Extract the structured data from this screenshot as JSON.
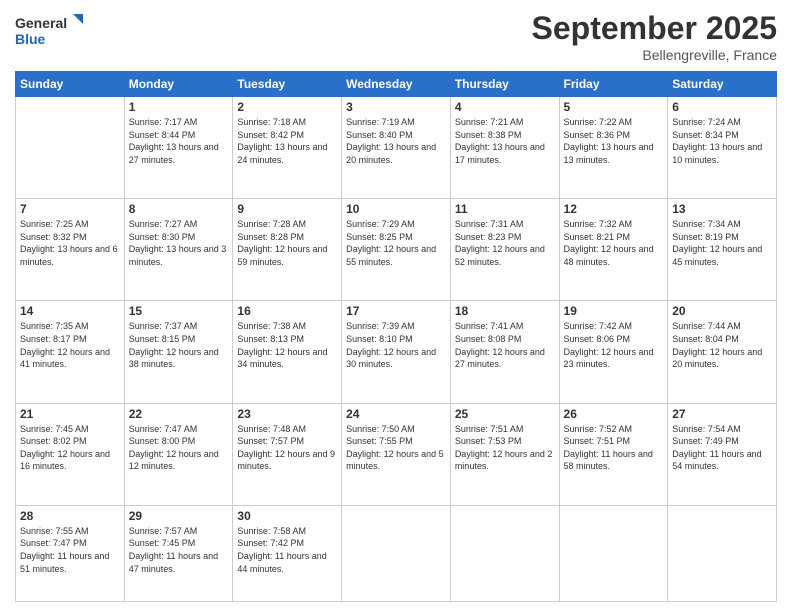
{
  "header": {
    "logo_general": "General",
    "logo_blue": "Blue",
    "month_title": "September 2025",
    "location": "Bellengreville, France"
  },
  "days_of_week": [
    "Sunday",
    "Monday",
    "Tuesday",
    "Wednesday",
    "Thursday",
    "Friday",
    "Saturday"
  ],
  "weeks": [
    [
      {
        "day": "",
        "sunrise": "",
        "sunset": "",
        "daylight": ""
      },
      {
        "day": "1",
        "sunrise": "Sunrise: 7:17 AM",
        "sunset": "Sunset: 8:44 PM",
        "daylight": "Daylight: 13 hours and 27 minutes."
      },
      {
        "day": "2",
        "sunrise": "Sunrise: 7:18 AM",
        "sunset": "Sunset: 8:42 PM",
        "daylight": "Daylight: 13 hours and 24 minutes."
      },
      {
        "day": "3",
        "sunrise": "Sunrise: 7:19 AM",
        "sunset": "Sunset: 8:40 PM",
        "daylight": "Daylight: 13 hours and 20 minutes."
      },
      {
        "day": "4",
        "sunrise": "Sunrise: 7:21 AM",
        "sunset": "Sunset: 8:38 PM",
        "daylight": "Daylight: 13 hours and 17 minutes."
      },
      {
        "day": "5",
        "sunrise": "Sunrise: 7:22 AM",
        "sunset": "Sunset: 8:36 PM",
        "daylight": "Daylight: 13 hours and 13 minutes."
      },
      {
        "day": "6",
        "sunrise": "Sunrise: 7:24 AM",
        "sunset": "Sunset: 8:34 PM",
        "daylight": "Daylight: 13 hours and 10 minutes."
      }
    ],
    [
      {
        "day": "7",
        "sunrise": "Sunrise: 7:25 AM",
        "sunset": "Sunset: 8:32 PM",
        "daylight": "Daylight: 13 hours and 6 minutes."
      },
      {
        "day": "8",
        "sunrise": "Sunrise: 7:27 AM",
        "sunset": "Sunset: 8:30 PM",
        "daylight": "Daylight: 13 hours and 3 minutes."
      },
      {
        "day": "9",
        "sunrise": "Sunrise: 7:28 AM",
        "sunset": "Sunset: 8:28 PM",
        "daylight": "Daylight: 12 hours and 59 minutes."
      },
      {
        "day": "10",
        "sunrise": "Sunrise: 7:29 AM",
        "sunset": "Sunset: 8:25 PM",
        "daylight": "Daylight: 12 hours and 55 minutes."
      },
      {
        "day": "11",
        "sunrise": "Sunrise: 7:31 AM",
        "sunset": "Sunset: 8:23 PM",
        "daylight": "Daylight: 12 hours and 52 minutes."
      },
      {
        "day": "12",
        "sunrise": "Sunrise: 7:32 AM",
        "sunset": "Sunset: 8:21 PM",
        "daylight": "Daylight: 12 hours and 48 minutes."
      },
      {
        "day": "13",
        "sunrise": "Sunrise: 7:34 AM",
        "sunset": "Sunset: 8:19 PM",
        "daylight": "Daylight: 12 hours and 45 minutes."
      }
    ],
    [
      {
        "day": "14",
        "sunrise": "Sunrise: 7:35 AM",
        "sunset": "Sunset: 8:17 PM",
        "daylight": "Daylight: 12 hours and 41 minutes."
      },
      {
        "day": "15",
        "sunrise": "Sunrise: 7:37 AM",
        "sunset": "Sunset: 8:15 PM",
        "daylight": "Daylight: 12 hours and 38 minutes."
      },
      {
        "day": "16",
        "sunrise": "Sunrise: 7:38 AM",
        "sunset": "Sunset: 8:13 PM",
        "daylight": "Daylight: 12 hours and 34 minutes."
      },
      {
        "day": "17",
        "sunrise": "Sunrise: 7:39 AM",
        "sunset": "Sunset: 8:10 PM",
        "daylight": "Daylight: 12 hours and 30 minutes."
      },
      {
        "day": "18",
        "sunrise": "Sunrise: 7:41 AM",
        "sunset": "Sunset: 8:08 PM",
        "daylight": "Daylight: 12 hours and 27 minutes."
      },
      {
        "day": "19",
        "sunrise": "Sunrise: 7:42 AM",
        "sunset": "Sunset: 8:06 PM",
        "daylight": "Daylight: 12 hours and 23 minutes."
      },
      {
        "day": "20",
        "sunrise": "Sunrise: 7:44 AM",
        "sunset": "Sunset: 8:04 PM",
        "daylight": "Daylight: 12 hours and 20 minutes."
      }
    ],
    [
      {
        "day": "21",
        "sunrise": "Sunrise: 7:45 AM",
        "sunset": "Sunset: 8:02 PM",
        "daylight": "Daylight: 12 hours and 16 minutes."
      },
      {
        "day": "22",
        "sunrise": "Sunrise: 7:47 AM",
        "sunset": "Sunset: 8:00 PM",
        "daylight": "Daylight: 12 hours and 12 minutes."
      },
      {
        "day": "23",
        "sunrise": "Sunrise: 7:48 AM",
        "sunset": "Sunset: 7:57 PM",
        "daylight": "Daylight: 12 hours and 9 minutes."
      },
      {
        "day": "24",
        "sunrise": "Sunrise: 7:50 AM",
        "sunset": "Sunset: 7:55 PM",
        "daylight": "Daylight: 12 hours and 5 minutes."
      },
      {
        "day": "25",
        "sunrise": "Sunrise: 7:51 AM",
        "sunset": "Sunset: 7:53 PM",
        "daylight": "Daylight: 12 hours and 2 minutes."
      },
      {
        "day": "26",
        "sunrise": "Sunrise: 7:52 AM",
        "sunset": "Sunset: 7:51 PM",
        "daylight": "Daylight: 11 hours and 58 minutes."
      },
      {
        "day": "27",
        "sunrise": "Sunrise: 7:54 AM",
        "sunset": "Sunset: 7:49 PM",
        "daylight": "Daylight: 11 hours and 54 minutes."
      }
    ],
    [
      {
        "day": "28",
        "sunrise": "Sunrise: 7:55 AM",
        "sunset": "Sunset: 7:47 PM",
        "daylight": "Daylight: 11 hours and 51 minutes."
      },
      {
        "day": "29",
        "sunrise": "Sunrise: 7:57 AM",
        "sunset": "Sunset: 7:45 PM",
        "daylight": "Daylight: 11 hours and 47 minutes."
      },
      {
        "day": "30",
        "sunrise": "Sunrise: 7:58 AM",
        "sunset": "Sunset: 7:42 PM",
        "daylight": "Daylight: 11 hours and 44 minutes."
      },
      {
        "day": "",
        "sunrise": "",
        "sunset": "",
        "daylight": ""
      },
      {
        "day": "",
        "sunrise": "",
        "sunset": "",
        "daylight": ""
      },
      {
        "day": "",
        "sunrise": "",
        "sunset": "",
        "daylight": ""
      },
      {
        "day": "",
        "sunrise": "",
        "sunset": "",
        "daylight": ""
      }
    ]
  ]
}
